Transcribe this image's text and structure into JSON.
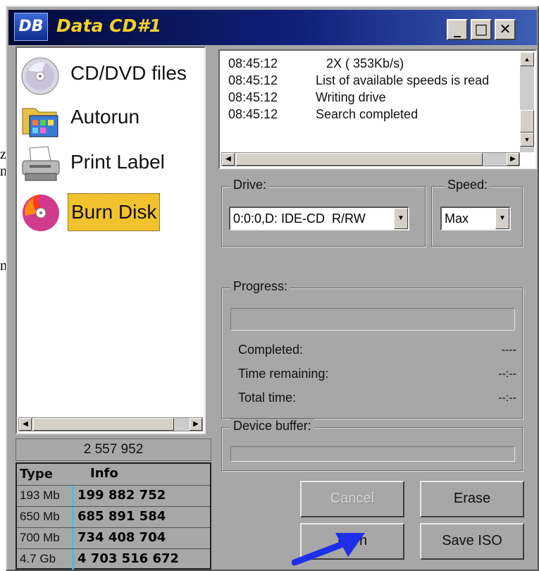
{
  "window": {
    "title": "Data CD#1",
    "icon_text": "DB",
    "controls": {
      "minimize": "_",
      "maximize": "□",
      "close": "✕"
    }
  },
  "background_fragments": [
    "z",
    "nt",
    "m"
  ],
  "nav": {
    "items": [
      {
        "label": "CD/DVD files",
        "icon": "disc-icon"
      },
      {
        "label": "Autorun",
        "icon": "autorun-folder-icon"
      },
      {
        "label": "Print Label",
        "icon": "printer-icon"
      },
      {
        "label": "Burn Disk",
        "icon": "burn-disc-icon",
        "selected": true
      }
    ]
  },
  "total_size": "2 557 952",
  "size_table": {
    "headers": {
      "type": "Type",
      "info": "Info"
    },
    "rows": [
      {
        "type": "193 Mb",
        "info": "199 882 752"
      },
      {
        "type": "650 Mb",
        "info": "685 891 584"
      },
      {
        "type": "700 Mb",
        "info": "734 408 704"
      },
      {
        "type": "4.7 Gb",
        "info": "4 703 516 672"
      }
    ]
  },
  "log": [
    {
      "time": "08:45:12",
      "message": "   2X ( 353Kb/s)"
    },
    {
      "time": "08:45:12",
      "message": "List of available speeds is read"
    },
    {
      "time": "08:45:12",
      "message": "Writing drive"
    },
    {
      "time": "08:45:12",
      "message": "Search completed"
    }
  ],
  "drive": {
    "label": "Drive:",
    "value": "0:0:0,D: IDE-CD  R/RW"
  },
  "speed": {
    "label": "Speed:",
    "value": "Max"
  },
  "progress": {
    "label": "Progress:",
    "fraction": 0,
    "completed_label": "Completed:",
    "completed_value": "----",
    "time_remaining_label": "Time remaining:",
    "time_remaining_value": "--:--",
    "total_time_label": "Total time:",
    "total_time_value": "--:--"
  },
  "device_buffer": {
    "label": "Device buffer:",
    "fraction": 0
  },
  "buttons": {
    "cancel": "Cancel",
    "erase": "Erase",
    "burn": "Burn",
    "save_iso": "Save ISO"
  },
  "colors": {
    "title_text": "#f3d02c",
    "selected_item": "#f2c22e",
    "window_bg": "#a7a7a7",
    "separator": "#3ec2e8",
    "pointer_arrow": "#1d2fe8"
  }
}
